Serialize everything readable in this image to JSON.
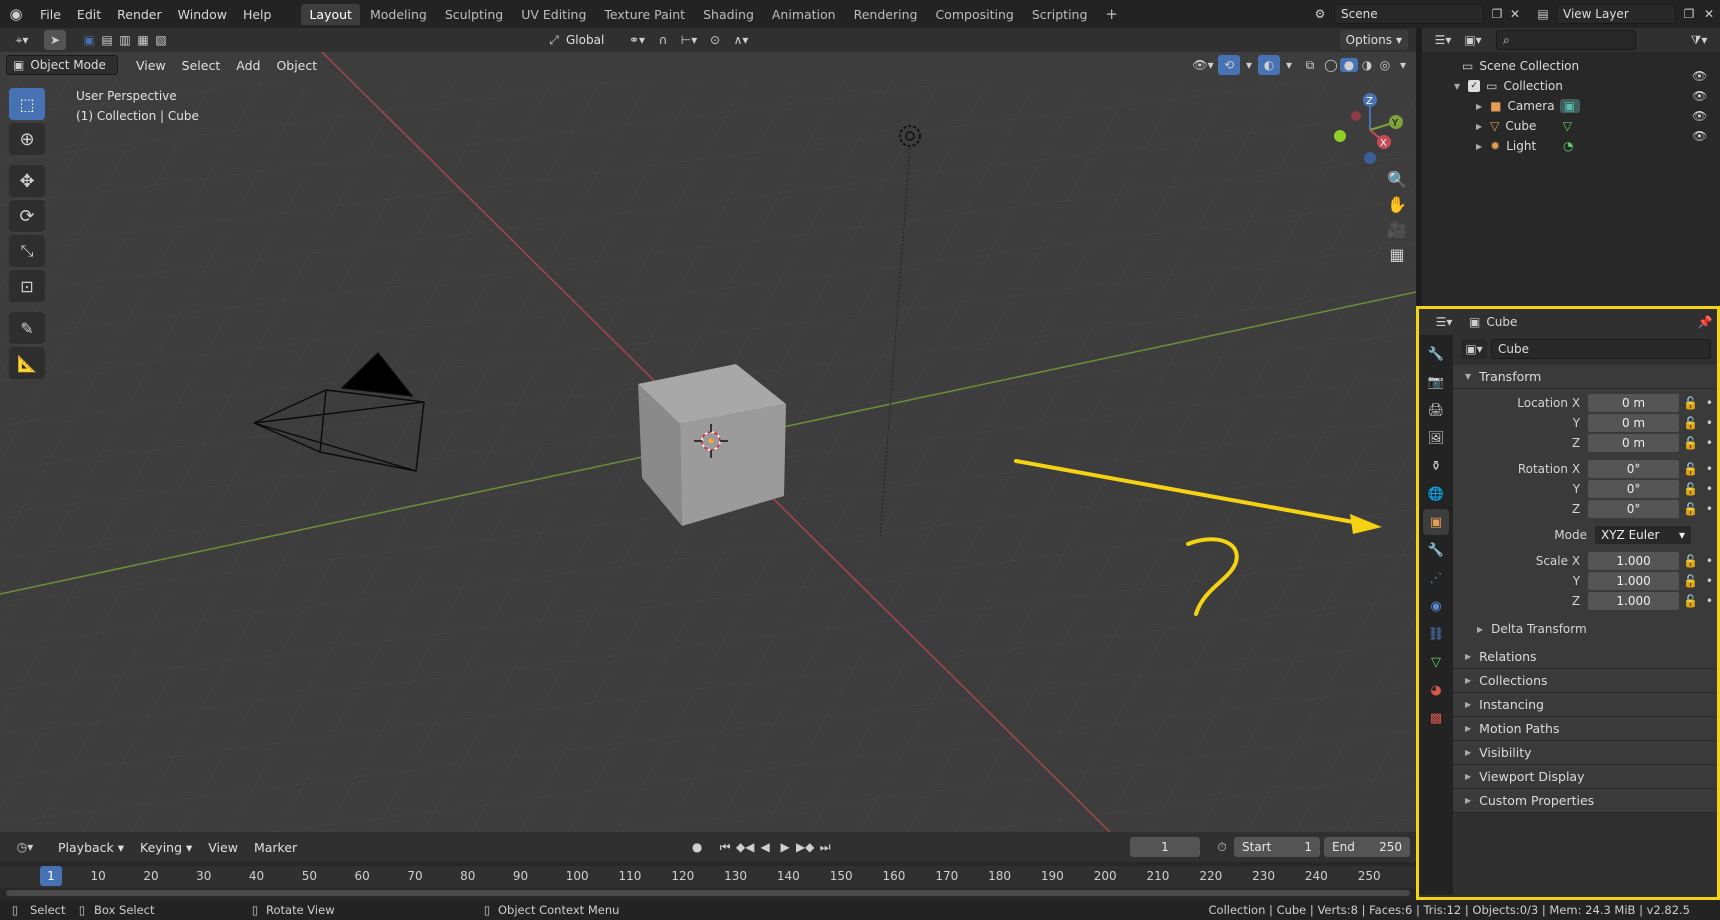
{
  "topbar": {
    "menus": [
      "File",
      "Edit",
      "Render",
      "Window",
      "Help"
    ],
    "workspaces": [
      "Layout",
      "Modeling",
      "Sculpting",
      "UV Editing",
      "Texture Paint",
      "Shading",
      "Animation",
      "Rendering",
      "Compositing",
      "Scripting"
    ],
    "active_workspace": "Layout",
    "add_tab": "+",
    "scene": "Scene",
    "view_layer": "View Layer"
  },
  "tool_header": {
    "orientation": "Global",
    "options": "Options"
  },
  "viewport_header": {
    "mode": "Object Mode",
    "menus": [
      "View",
      "Select",
      "Add",
      "Object"
    ]
  },
  "viewport": {
    "perspective": "User Perspective",
    "collection_info": "(1) Collection | Cube",
    "annotation_question": "?",
    "gizmo": {
      "z": "Z",
      "y": "Y",
      "x": "X"
    }
  },
  "outliner": {
    "root": "Scene Collection",
    "collection": "Collection",
    "items": [
      "Camera",
      "Cube",
      "Light"
    ]
  },
  "properties": {
    "object_name_header": "Cube",
    "object_name_field": "Cube",
    "transform_label": "Transform",
    "location": {
      "label_x": "Location X",
      "label_y": "Y",
      "label_z": "Z",
      "x": "0 m",
      "y": "0 m",
      "z": "0 m"
    },
    "rotation": {
      "label_x": "Rotation X",
      "label_y": "Y",
      "label_z": "Z",
      "x": "0°",
      "y": "0°",
      "z": "0°"
    },
    "mode_label": "Mode",
    "mode_value": "XYZ Euler",
    "scale": {
      "label_x": "Scale X",
      "label_y": "Y",
      "label_z": "Z",
      "x": "1.000",
      "y": "1.000",
      "z": "1.000"
    },
    "delta_transform": "Delta Transform",
    "panels": [
      "Relations",
      "Collections",
      "Instancing",
      "Motion Paths",
      "Visibility",
      "Viewport Display",
      "Custom Properties"
    ]
  },
  "timeline": {
    "menus": [
      "Playback",
      "Keying",
      "View",
      "Marker"
    ],
    "current_frame": "1",
    "start_label": "Start",
    "start_value": "1",
    "end_label": "End",
    "end_value": "250",
    "ticks": [
      "1",
      "10",
      "20",
      "30",
      "40",
      "50",
      "60",
      "70",
      "80",
      "90",
      "100",
      "110",
      "120",
      "130",
      "140",
      "150",
      "160",
      "170",
      "180",
      "190",
      "200",
      "210",
      "220",
      "230",
      "240",
      "250"
    ]
  },
  "statusbar": {
    "select": "Select",
    "box_select": "Box Select",
    "rotate_view": "Rotate View",
    "context_menu": "Object Context Menu",
    "stats": "Collection | Cube | Verts:8 | Faces:6 | Tris:12 | Objects:0/3 | Mem: 24.3 MiB | v2.82.5"
  },
  "colors": {
    "accent": "#4772b3",
    "annotation": "#f5d312",
    "x_axis": "#c84a55",
    "y_axis": "#7ea33a"
  }
}
